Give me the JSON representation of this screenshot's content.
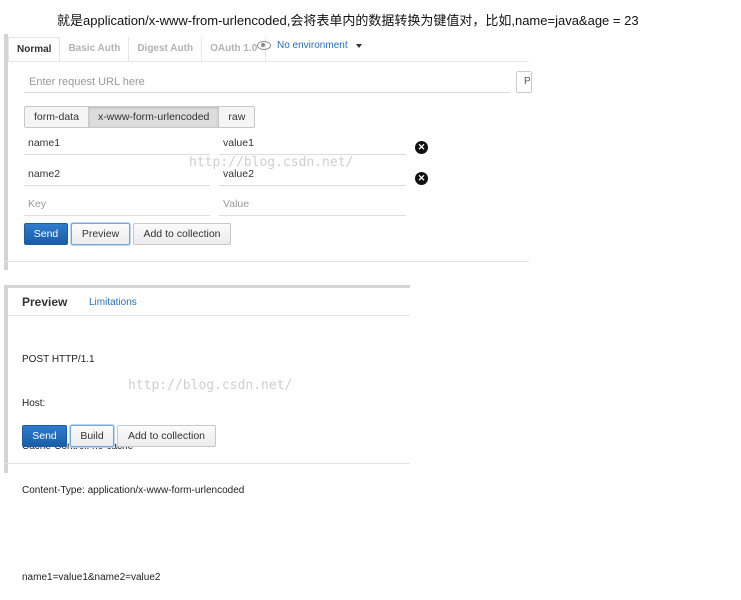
{
  "caption": "就是application/x-www-from-urlencoded,会将表单内的数据转换为键值对，比如,name=java&age = 23",
  "tabs": [
    "Normal",
    "Basic Auth",
    "Digest Auth",
    "OAuth 1.0"
  ],
  "environment": "No environment",
  "request_url_placeholder": "Enter request URL here",
  "params_button": "Params",
  "body_modes": [
    "form-data",
    "x-www-form-urlencoded",
    "raw"
  ],
  "params": [
    {
      "key": "name1",
      "value": "value1"
    },
    {
      "key": "name2",
      "value": "value2"
    }
  ],
  "key_placeholder": "Key",
  "value_placeholder": "Value",
  "actions": {
    "send": "Send",
    "preview": "Preview",
    "add_to_collection": "Add to collection"
  },
  "watermark": "http://blog.csdn.net/",
  "preview": {
    "title": "Preview",
    "limitations": "Limitations",
    "lines": [
      "POST HTTP/1.1",
      "Host:",
      "Cache-Control: no-cache",
      "Content-Type: application/x-www-form-urlencoded",
      "",
      "name1=value1&name2=value2"
    ],
    "send": "Send",
    "build": "Build",
    "add_to_collection": "Add to collection"
  }
}
